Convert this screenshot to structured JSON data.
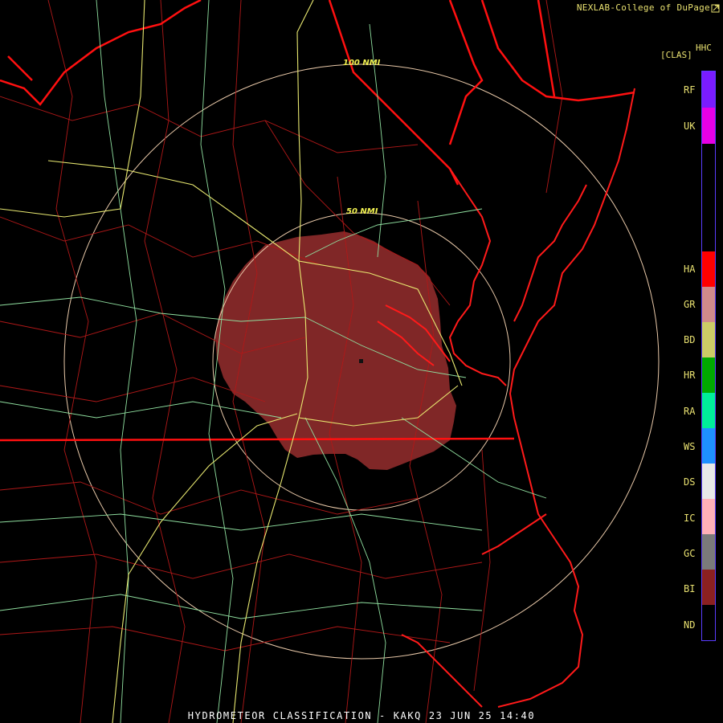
{
  "header": {
    "credit": "NEXLAB-College of DuPage",
    "product_code": "HHC",
    "product_unit": "[CLAS]"
  },
  "rings": {
    "inner_label": "50 NMI",
    "outer_label": "100 NMI"
  },
  "legend": {
    "items": [
      {
        "code": "RF",
        "color": "#7a1cff"
      },
      {
        "code": "UK",
        "color": "#e600e6"
      },
      {
        "code": "HA",
        "color": "#ff0000"
      },
      {
        "code": "GR",
        "color": "#d08a8a"
      },
      {
        "code": "BD",
        "color": "#cccc66"
      },
      {
        "code": "HR",
        "color": "#00aa00"
      },
      {
        "code": "RA",
        "color": "#00ee99"
      },
      {
        "code": "WS",
        "color": "#1e90ff"
      },
      {
        "code": "DS",
        "color": "#e8e8e8"
      },
      {
        "code": "IC",
        "color": "#ffb0b8"
      },
      {
        "code": "GC",
        "color": "#7a7a7a"
      },
      {
        "code": "BI",
        "color": "#8b2020"
      },
      {
        "code": "ND",
        "color": "#000000"
      }
    ]
  },
  "footer": {
    "title": "HYDROMETEOR CLASSIFICATION - KAKQ 23 JUN 25 14:40"
  }
}
